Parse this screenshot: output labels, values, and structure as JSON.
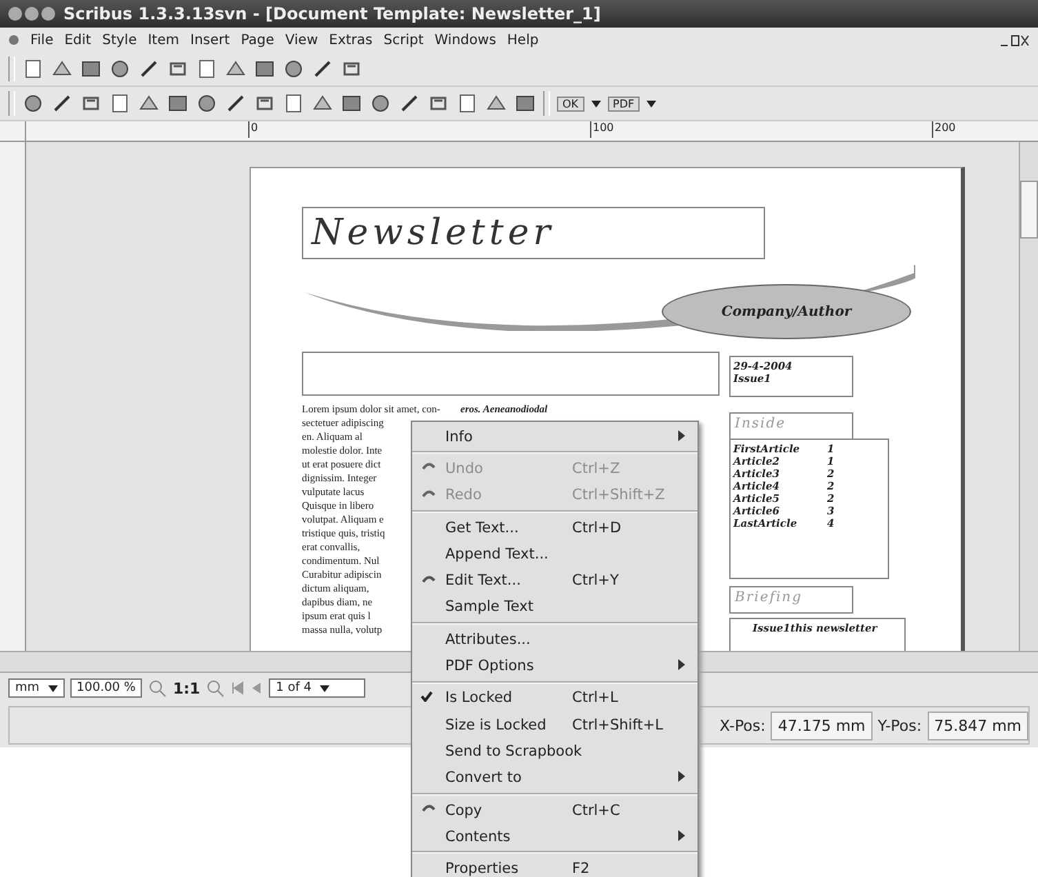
{
  "window": {
    "title": "Scribus 1.3.3.13svn - [Document Template: Newsletter_1]"
  },
  "menubar": [
    "File",
    "Edit",
    "Style",
    "Item",
    "Insert",
    "Page",
    "View",
    "Extras",
    "Script",
    "Windows",
    "Help"
  ],
  "ruler": {
    "ticks": [
      "0",
      "100",
      "200"
    ]
  },
  "document": {
    "title": "Newsletter",
    "author_badge": "Company/Author",
    "date_lines": [
      "29-4-2004",
      "Issue1"
    ],
    "inside_heading": "Inside",
    "contents": [
      {
        "title": "FirstArticle",
        "page": "1"
      },
      {
        "title": "Article2",
        "page": "1"
      },
      {
        "title": "Article3",
        "page": "2"
      },
      {
        "title": "Article4",
        "page": "2"
      },
      {
        "title": "Article5",
        "page": "2"
      },
      {
        "title": "Article6",
        "page": "3"
      },
      {
        "title": "LastArticle",
        "page": "4"
      }
    ],
    "briefing_heading": "Briefing",
    "briefing_text": "Issue1this newsletter",
    "body_lines": [
      "Lorem ipsum dolor sit amet, con-",
      "sectetuer adipiscing",
      "en. Aliquam al",
      "molestie dolor. Inte",
      "ut erat posuere dict",
      "dignissim. Integer",
      "vulputate lacus",
      "Quisque in libero",
      "volutpat. Aliquam e",
      "tristique quis, tristiq",
      "erat convallis,",
      "condimentum. Nul",
      "Curabitur adipiscin",
      "dictum aliquam,",
      "dapibus diam, ne",
      "ipsum erat quis l",
      "massa nulla, volutp"
    ],
    "column_2_text": "eros. Aeneanodiodal"
  },
  "toolbar_dropdowns": [
    "OK",
    "PDF"
  ],
  "bottom_bar": {
    "unit": "mm",
    "zoom": "100.00 %",
    "actual_size": "1:1",
    "page": "1 of 4"
  },
  "status_bar": {
    "xpos_label": "X-Pos:",
    "xpos": "47.175 mm",
    "ypos_label": "Y-Pos:",
    "ypos": "75.847 mm"
  },
  "context_menu": [
    {
      "kind": "item",
      "label": "Info",
      "submenu": true,
      "disabled": false,
      "checked": false
    },
    {
      "kind": "separator"
    },
    {
      "kind": "item",
      "label": "Undo",
      "shortcut": "Ctrl+Z",
      "submenu": false,
      "disabled": true,
      "checked": false
    },
    {
      "kind": "item",
      "label": "Redo",
      "shortcut": "Ctrl+Shift+Z",
      "submenu": false,
      "disabled": true,
      "checked": false
    },
    {
      "kind": "separator"
    },
    {
      "kind": "item",
      "label": "Get Text...",
      "shortcut": "Ctrl+D",
      "submenu": false,
      "disabled": false,
      "checked": false
    },
    {
      "kind": "item",
      "label": "Append Text...",
      "submenu": false,
      "disabled": false,
      "checked": false
    },
    {
      "kind": "item",
      "label": "Edit Text...",
      "shortcut": "Ctrl+Y",
      "submenu": false,
      "disabled": false,
      "checked": false
    },
    {
      "kind": "item",
      "label": "Sample Text",
      "submenu": false,
      "disabled": false,
      "checked": false
    },
    {
      "kind": "separator"
    },
    {
      "kind": "item",
      "label": "Attributes...",
      "submenu": false,
      "disabled": false,
      "checked": false
    },
    {
      "kind": "item",
      "label": "PDF Options",
      "submenu": true,
      "disabled": false,
      "checked": false
    },
    {
      "kind": "separator"
    },
    {
      "kind": "item",
      "label": "Is Locked",
      "shortcut": "Ctrl+L",
      "submenu": false,
      "disabled": false,
      "checked": true
    },
    {
      "kind": "item",
      "label": "Size is Locked",
      "shortcut": "Ctrl+Shift+L",
      "submenu": false,
      "disabled": false,
      "checked": false
    },
    {
      "kind": "item",
      "label": "Send to Scrapbook",
      "submenu": false,
      "disabled": false,
      "checked": false
    },
    {
      "kind": "item",
      "label": "Convert to",
      "submenu": true,
      "disabled": false,
      "checked": false
    },
    {
      "kind": "separator"
    },
    {
      "kind": "item",
      "label": "Copy",
      "shortcut": "Ctrl+C",
      "submenu": false,
      "disabled": false,
      "checked": false
    },
    {
      "kind": "item",
      "label": "Contents",
      "submenu": true,
      "disabled": false,
      "checked": false
    },
    {
      "kind": "separator"
    },
    {
      "kind": "item",
      "label": "Properties",
      "shortcut": "F2",
      "submenu": false,
      "disabled": false,
      "checked": false
    }
  ]
}
